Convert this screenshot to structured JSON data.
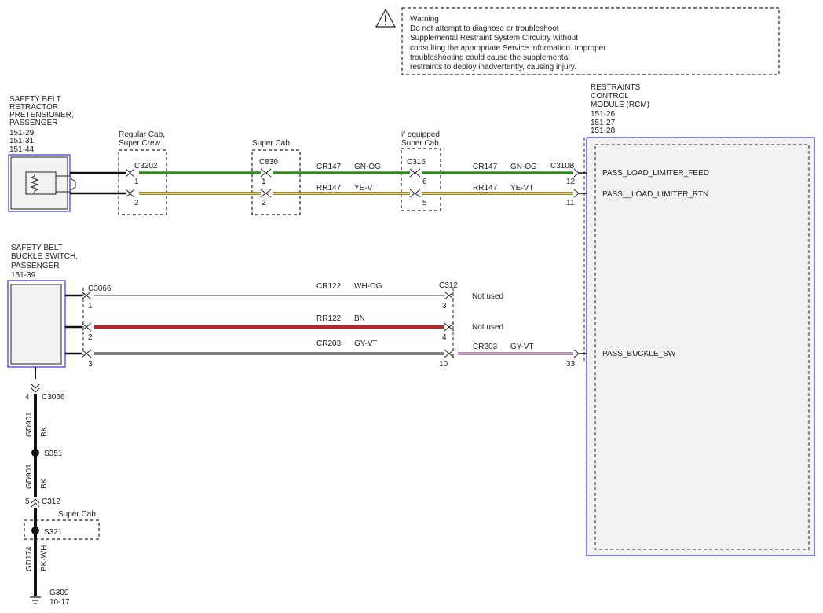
{
  "warning": {
    "lines": [
      "Warning",
      "Do not attempt to diagnose or troubleshoot",
      "Supplemental Restraint System Circuitry without",
      "consulting the appropriate Service Information. Improper",
      "troubleshooting could cause the supplemental",
      "restraints to deploy inadvertently, causing injury."
    ]
  },
  "components": {
    "retractor": {
      "lines": [
        "SAFETY BELT",
        "RETRACTOR",
        "PRETENSIONER,",
        "PASSENGER",
        "151-29",
        "151-31",
        "151-44"
      ]
    },
    "buckle": {
      "lines": [
        "SAFETY BELT",
        "BUCKLE SWITCH,",
        "PASSENGER",
        "151-39"
      ]
    },
    "rcm": {
      "lines": [
        "RESTRAINTS",
        "CONTROL",
        "MODULE (RCM)",
        "151-26",
        "151-27",
        "151-28"
      ]
    }
  },
  "boxes": {
    "c3202_box": [
      "Regular Cab,",
      "Super Crew"
    ],
    "c830_box": [
      "Super Cab"
    ],
    "c316_box": [
      "if equipped",
      "Super Cab"
    ],
    "s321_box": "Super Cab"
  },
  "connectors": {
    "c3202": "C3202",
    "c830": "C830",
    "c316": "C316",
    "c310b": "C310B",
    "c3066_top": "C3066",
    "c312_top": "C312",
    "c3066_bottom": "C3066",
    "c312_bottom": "C312"
  },
  "pins": {
    "c3202_1": "1",
    "c3202_2": "2",
    "c830_1": "1",
    "c830_2": "2",
    "c316_6": "6",
    "c316_5": "5",
    "c310b_12": "12",
    "c310b_11": "11",
    "c3066_1": "1",
    "c3066_2": "2",
    "c3066_3": "3",
    "c312_3": "3",
    "c312_4": "4",
    "c312_10": "10",
    "c310b_33": "33",
    "c3066_4": "4",
    "c312_5": "5"
  },
  "wires": {
    "cr147_a": {
      "circuit": "CR147",
      "color": "GN-OG"
    },
    "cr147_b": {
      "circuit": "CR147",
      "color": "GN-OG"
    },
    "rr147_a": {
      "circuit": "RR147",
      "color": "YE-VT"
    },
    "rr147_b": {
      "circuit": "RR147",
      "color": "YE-VT"
    },
    "cr122": {
      "circuit": "CR122",
      "color": "WH-OG"
    },
    "rr122": {
      "circuit": "RR122",
      "color": "BN"
    },
    "cr203_a": {
      "circuit": "CR203",
      "color": "GY-VT"
    },
    "cr203_b": {
      "circuit": "CR203",
      "color": "GY-VT"
    },
    "gd901_a": {
      "circuit": "GD901",
      "color": "BK"
    },
    "gd901_b": {
      "circuit": "GD901",
      "color": "BK"
    },
    "gd174": {
      "circuit": "GD174",
      "color": "BK-WH"
    }
  },
  "notes": {
    "not_used_1": "Not used",
    "not_used_2": "Not used"
  },
  "signals": {
    "feed": "PASS_LOAD_LIMITER_FEED",
    "rtn": "PASS__LOAD_LIMITER_RTN",
    "buckle": "PASS_BUCKLE_SW"
  },
  "splices": {
    "s351": "S351",
    "s321": "S321"
  },
  "ground": {
    "name": "G300",
    "ref": "10-17"
  },
  "colors": {
    "green": "#2e8b1e",
    "yellow": "#e8d45a",
    "brown": "#b22222",
    "gray": "#808080",
    "violet": "#c8a0c8",
    "black": "#111111",
    "blue": "#3333cc",
    "module_fill": "#f2f2f2"
  }
}
